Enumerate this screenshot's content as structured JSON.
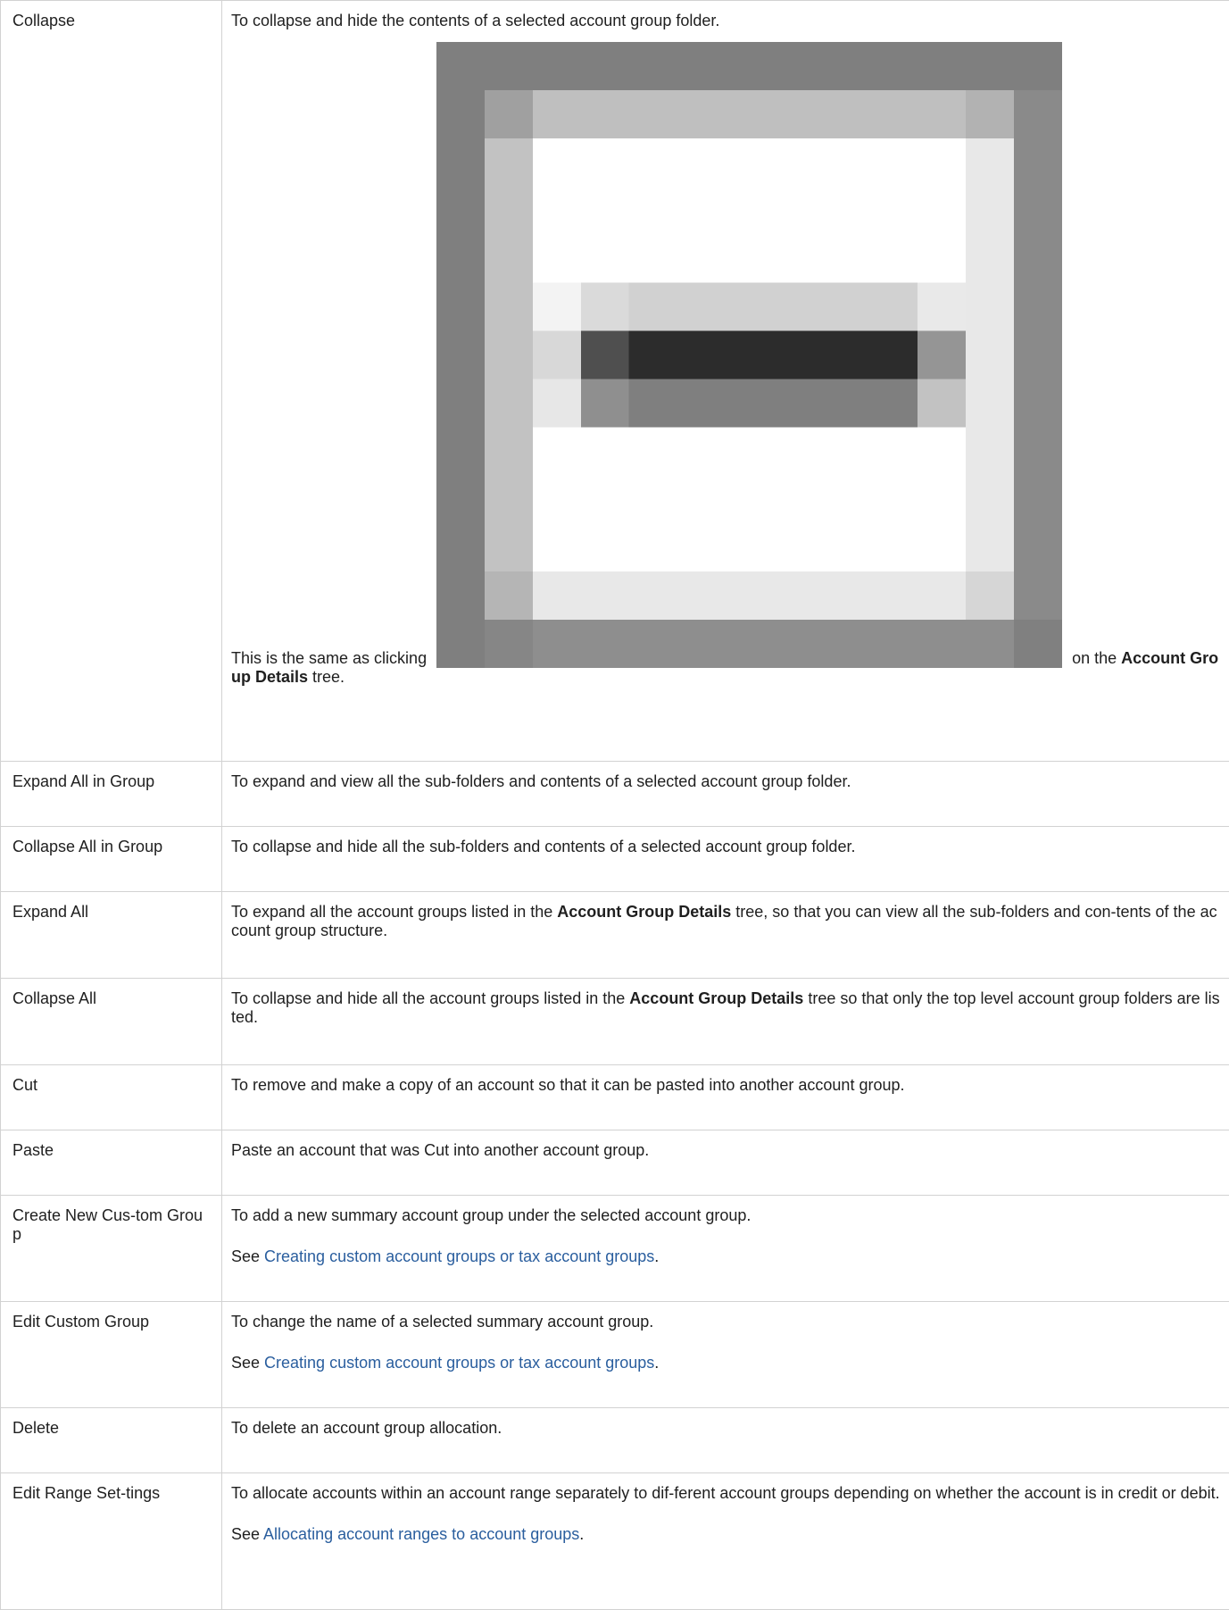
{
  "rows": [
    {
      "command": "Collapse",
      "desc_1": "To collapse and hide the contents of a selected account group folder.",
      "desc_2_before": "This is the same as clicking ",
      "icon": "collapse-minus-icon",
      "desc_2_after": " on the ",
      "desc_2_bold": "Account Group Details",
      "desc_2_end": " tree."
    },
    {
      "command": "Expand All in Group",
      "desc": "To expand and view all the sub-folders and contents of a selected account group folder."
    },
    {
      "command": "Collapse All in Group",
      "desc": "To collapse and hide all the sub-folders and contents of a selected account group folder."
    },
    {
      "command": "Expand All",
      "desc_before": "To expand all the account groups listed in the ",
      "desc_bold": "Account Group Details",
      "desc_after": " tree, so that you can view all the sub-folders and con-tents of the account group structure."
    },
    {
      "command": "Collapse All",
      "desc_before": "To collapse and hide all the account groups listed in the ",
      "desc_bold": "Account Group Details",
      "desc_after": " tree so that only the top level account group folders are listed."
    },
    {
      "command": "Cut",
      "desc": "To remove and make a copy of an account so that it can be pasted into another account group."
    },
    {
      "command": "Paste",
      "desc": "Paste an account that was Cut into another account group."
    },
    {
      "command": "Create New Cus-tom Group",
      "desc": "To add a new summary account group under the selected account group.",
      "see_label": "See ",
      "see_link": "Creating custom account groups or tax account groups",
      "see_end": "."
    },
    {
      "command": "Edit Custom Group",
      "desc": "To change the name of a selected summary account group.",
      "see_label": "See ",
      "see_link": "Creating custom account groups or tax account groups",
      "see_end": "."
    },
    {
      "command": "Delete",
      "desc": "To delete an account group allocation."
    },
    {
      "command": "Edit Range Set-tings",
      "desc": "To allocate accounts within an account range separately to dif-ferent account groups depending on whether the account is in credit or debit.",
      "see_label": "See ",
      "see_link": "Allocating account ranges to account groups",
      "see_end": "."
    }
  ],
  "colors": {
    "link": "#2a5e9e",
    "border": "#d2d2d2"
  }
}
